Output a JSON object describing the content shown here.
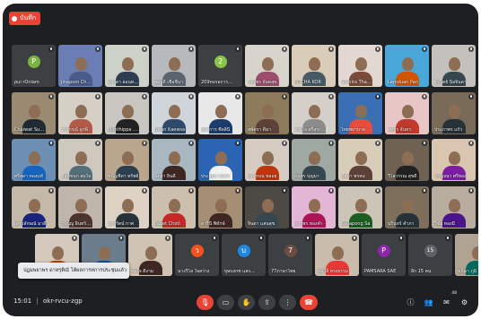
{
  "recording_label": "บันทึก",
  "toast_text": "ปฏมพยาพร ดาหรุติณั โต้ผลการทการประชุมแล้ว",
  "bottom_bar": {
    "time": "15:01",
    "separator": "|",
    "meeting_code": "okr-rvcu-zgp",
    "participant_count": "48"
  },
  "controls": [
    {
      "name": "mic-muted-button",
      "glyph": "🎙"
    },
    {
      "name": "camera-button",
      "glyph": "▭"
    },
    {
      "name": "raise-hand-button",
      "glyph": "✋"
    },
    {
      "name": "present-button",
      "glyph": "⇪"
    },
    {
      "name": "more-options-button",
      "glyph": "⋮"
    },
    {
      "name": "leave-call-button",
      "glyph": "☎"
    }
  ],
  "right_controls": [
    {
      "name": "info-icon",
      "glyph": "ⓘ"
    },
    {
      "name": "people-icon",
      "glyph": "👥"
    },
    {
      "name": "chat-icon",
      "glyph": "✉"
    },
    {
      "name": "activities-icon",
      "glyph": "⚙"
    }
  ],
  "tiles": [
    {
      "label": "pui rOnlam",
      "kind": "avatar",
      "avatar_letter": "P",
      "avatar_color": "#7cb342",
      "bg": "#3c4043"
    },
    {
      "label": "Jinapom Chom",
      "kind": "photo",
      "bg": "#6a7db5",
      "shirt": "#4a5a8a"
    },
    {
      "label": "สุจาดา อ่อนทองคำ",
      "kind": "photo",
      "bg": "#cdd2c8",
      "shirt": "#2d3e50"
    },
    {
      "label": "สมฤดี เชื้อชีนา",
      "kind": "photo",
      "bg": "#b7b9bd",
      "shirt": "#5c6470"
    },
    {
      "label": "209หอรอการ เบ",
      "kind": "avatar",
      "avatar_letter": "2",
      "avatar_color": "#8bc34a",
      "bg": "#3c4043"
    },
    {
      "label": "วัชรพร จันทสุข",
      "kind": "photo",
      "bg": "#d8d4cc",
      "shirt": "#9b4d6b"
    },
    {
      "label": "PITCHA KOR",
      "kind": "photo",
      "bg": "#d9ccb8",
      "shirt": "#455a64"
    },
    {
      "label": "Suthira Thavont",
      "kind": "photo",
      "bg": "#e3d7d1",
      "shirt": "#7a4a3a"
    },
    {
      "label": "Lamduan Pan",
      "kind": "photo",
      "bg": "#4aa7d9",
      "shirt": "#d35400"
    },
    {
      "label": "ฐานิตย์ นิลจินดา",
      "kind": "photo",
      "bg": "#c4c1bc",
      "shirt": "#37474f"
    },
    {
      "label": "Chaiwat Suebsaeng",
      "kind": "photo",
      "bg": "#9a8a72",
      "shirt": "#1f2a33"
    },
    {
      "label": "วราภรณ์ ลูกษี",
      "kind": "photo",
      "bg": "#d6cfc6",
      "shirt": "#b35a48"
    },
    {
      "label": "Monthippa Suwa",
      "kind": "photo",
      "bg": "#c9c5c0",
      "shirt": "#222222"
    },
    {
      "label": "Niran Kaewsa",
      "kind": "photo",
      "bg": "#cfd5d9",
      "shirt": "#2e4a6b"
    },
    {
      "label": "ผู้จัดการ ซีลลินี",
      "kind": "photo",
      "bg": "#e8e8e8",
      "shirt": "#1b3d6d"
    },
    {
      "label": "สุพัตรา ดีมา",
      "kind": "photo",
      "bg": "#8d7b5b",
      "shirt": "#5d4037"
    },
    {
      "label": "ดวงใจ ศรีสุข",
      "kind": "photo",
      "bg": "#d5cfc9",
      "shirt": "#8c8c8c"
    },
    {
      "label": "ไทยพยาบาล",
      "kind": "photo",
      "bg": "#3a6fb5",
      "shirt": "#e74c3c"
    },
    {
      "label": "ศศิธร จันทร",
      "kind": "photo",
      "bg": "#e9c6c6",
      "shirt": "#c0392b"
    },
    {
      "label": "ประภาพร แก้ว",
      "kind": "photo",
      "bg": "#7a6a58",
      "shirt": "#263238"
    },
    {
      "label": "ศรีสุดา ทองแท้",
      "kind": "photo",
      "bg": "#6c8fb3",
      "shirt": "#1565c0"
    },
    {
      "label": "พิมพ์ชนก สมใจ",
      "kind": "photo",
      "bg": "#cfc8be",
      "shirt": "#546e7a"
    },
    {
      "label": "ชนัญชิดา ทรัพย์",
      "kind": "photo",
      "bg": "#b9a68d",
      "shirt": "#2c3e50"
    },
    {
      "label": "นิตยา ยินดี",
      "kind": "photo",
      "bg": "#a9b7c0",
      "shirt": "#3e2723"
    },
    {
      "label": "ประยุทธ จันทร์",
      "kind": "photo",
      "bg": "#2b64b2",
      "shirt": "#f1f1f1"
    },
    {
      "label": "อรวรรณ พลอย",
      "kind": "photo",
      "bg": "#d7ccc1",
      "shirt": "#bf360c"
    },
    {
      "label": "ธนพร บุญมา",
      "kind": "photo",
      "bg": "#9fa8a3",
      "shirt": "#37474f"
    },
    {
      "label": "ปัทมา พรหม",
      "kind": "photo",
      "bg": "#d8cdb8",
      "shirt": "#5d4037"
    },
    {
      "label": "วิไลวรรณ สุขดี",
      "kind": "photo",
      "bg": "#6f6252",
      "shirt": "#212121"
    },
    {
      "label": "กาญจนา ศรีทอง",
      "kind": "photo",
      "bg": "#d9c5b0",
      "shirt": "#7b1fa2"
    },
    {
      "label": "เสาวลักษณ์ มาดี",
      "kind": "photo",
      "bg": "#c4b8a8",
      "shirt": "#1a237e"
    },
    {
      "label": "วรัญญู อินทร์ศรีมณี",
      "kind": "photo",
      "bg": "#bfb5aa",
      "shirt": "#4e342e"
    },
    {
      "label": "สุดารัตน์ กาศ",
      "kind": "photo",
      "bg": "#ddd2c4",
      "shirt": "#263238"
    },
    {
      "label": "Pabet Choti",
      "kind": "photo",
      "bg": "#cdbfae",
      "shirt": "#c62828"
    },
    {
      "label": "ดารินี พิทักษ์",
      "kind": "photo",
      "bg": "#a48e74",
      "shirt": "#3e2723"
    },
    {
      "label": "จินดา แสนสุข",
      "kind": "photo",
      "bg": "#4d4a45",
      "shirt": "#37474f"
    },
    {
      "label": "สุภาพร ทองคำ",
      "kind": "photo",
      "bg": "#e2b6d4",
      "shirt": "#ad1457"
    },
    {
      "label": "Kullapong Sa",
      "kind": "photo",
      "bg": "#ccc4b7",
      "shirt": "#1b5e20"
    },
    {
      "label": "นรินทร์ คำภา",
      "kind": "photo",
      "bg": "#7e6f5d",
      "shirt": "#263238"
    },
    {
      "label": "วิชัย ทองมี",
      "kind": "photo",
      "bg": "#b8ad9e",
      "shirt": "#4a148c"
    },
    {
      "label": "Somsri Ja",
      "kind": "photo",
      "bg": "#d4c9bc",
      "shirt": "#bf360c"
    },
    {
      "label": "ธนัชพร แก้วใส",
      "kind": "photo",
      "bg": "#6b7d8c",
      "shirt": "#0d47a1"
    },
    {
      "label": "สมใจ ดีงาม",
      "kind": "photo",
      "bg": "#d1c3b1",
      "shirt": "#3e2723"
    },
    {
      "label": "นางวิไล ใจสว่าง",
      "kind": "avatar",
      "avatar_letter": "ว",
      "avatar_color": "#f4511e",
      "bg": "#3c4043"
    },
    {
      "label": "บุษบงกช แสงจันทร์",
      "kind": "avatar",
      "avatar_letter": "บ",
      "avatar_color": "#1e88e5",
      "bg": "#3c4043"
    },
    {
      "label": "77ภาษาไทย ",
      "kind": "avatar",
      "avatar_letter": "7",
      "avatar_color": "#6d4c41",
      "bg": "#3c4043"
    },
    {
      "label": "สุมาลี ทรงธรรม",
      "kind": "photo",
      "bg": "#c9bcac",
      "shirt": "#e53935"
    },
    {
      "label": "PAMSARA SAE",
      "kind": "avatar",
      "avatar_letter": "P",
      "avatar_color": "#8e24aa",
      "bg": "#3c4043"
    },
    {
      "label": "อีก 15 คน",
      "kind": "avatar",
      "avatar_letter": "15",
      "avatar_color": "#5f6368",
      "bg": "#3c4043"
    },
    {
      "label": "ชนิดา ภูมิ",
      "kind": "photo",
      "bg": "#b0a392",
      "shirt": "#00695c"
    }
  ]
}
